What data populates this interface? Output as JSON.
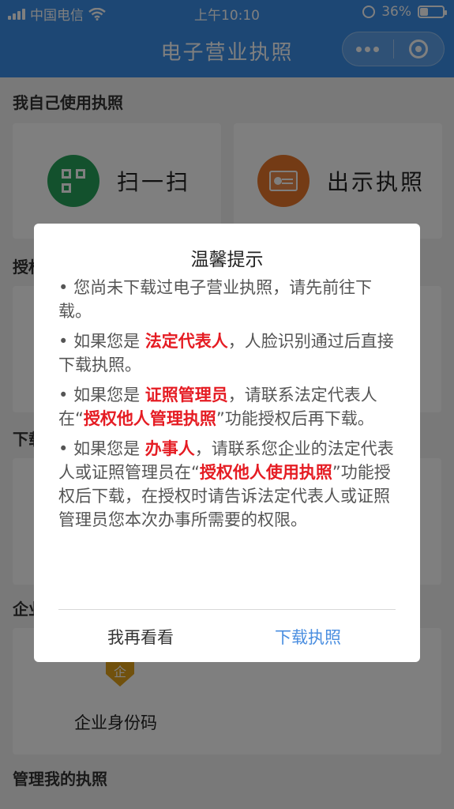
{
  "status_bar": {
    "carrier": "中国电信",
    "time": "上午10:10",
    "battery_percent": "36%",
    "battery_level": 0.36
  },
  "nav": {
    "title": "电子营业执照"
  },
  "page": {
    "section_self": "我自己使用执照",
    "scan_label": "扫一扫",
    "show_license_label": "出示执照",
    "section_authorized": "授权",
    "section_download": "下载",
    "section_enterprise": "企业",
    "enterprise_badge": "企",
    "enterprise_id_label": "企业身份码",
    "section_manage": "管理我的执照"
  },
  "dialog": {
    "title": "温馨提示",
    "bullet": "•",
    "p1": "您尚未下载过电子营业执照，请先前往下载。",
    "p2_pre": "如果您是",
    "p2_red": "法定代表人",
    "p2_post": "，人脸识别通过后直接下载执照。",
    "p3_pre": "如果您是",
    "p3_red": "证照管理员",
    "p3_mid": "，请联系法定代表人在“",
    "p3_red2": "授权他人管理执照",
    "p3_post": "”功能授权后再下载。",
    "p4_pre": "如果您是",
    "p4_red": "办事人",
    "p4_mid": "，请联系您企业的法定代表人或证照管理员在“",
    "p4_red2": "授权他人使用执照",
    "p4_post": "”功能授权后下载，在授权时请告诉法定代表人或证照管理员您本次办事所需要的权限。",
    "cancel": "我再看看",
    "confirm": "下载执照"
  },
  "colors": {
    "nav_bg": "#3b8fe9",
    "scan_icon_bg": "#27a35a",
    "license_icon_bg": "#e9762b",
    "emphasis_red": "#e51c23",
    "confirm_blue": "#4a8ee0"
  }
}
